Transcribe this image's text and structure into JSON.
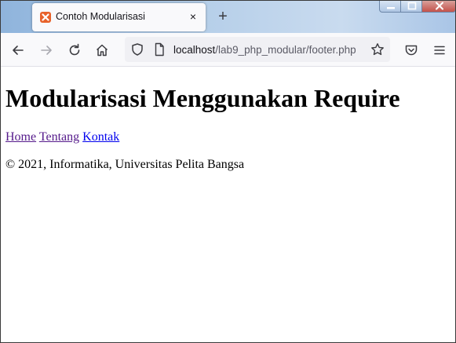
{
  "browser": {
    "tab": {
      "title": "Contoh Modularisasi",
      "favicon": "xampp-favicon-icon",
      "close": "×"
    },
    "new_tab_symbol": "+",
    "url": {
      "host": "localhost",
      "path": "/lab9_php_modular/footer.php"
    }
  },
  "page": {
    "heading": "Modularisasi Menggunakan Require",
    "nav": [
      {
        "label": "Home",
        "state": "visited"
      },
      {
        "label": "Tentang",
        "state": "visited"
      },
      {
        "label": "Kontak",
        "state": "unvisited"
      }
    ],
    "footer": "© 2021, Informatika, Universitas Pelita Bangsa"
  },
  "colors": {
    "link_visited": "#551a8b",
    "link_unvisited": "#0000ee",
    "favicon": "#e8622a"
  }
}
